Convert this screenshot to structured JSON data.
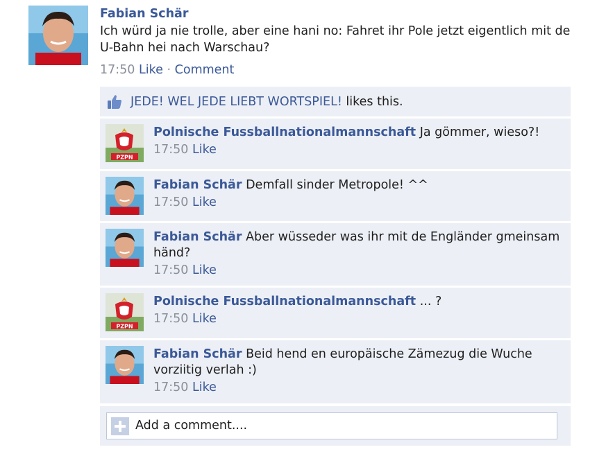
{
  "post": {
    "author": "Fabian Schär",
    "text": "Ich würd ja nie trolle, aber eine hani no: Fahret ihr Pole jetzt eigentlich mit de U-Bahn hei nach Warschau?",
    "time": "17:50",
    "like_label": "Like",
    "separator": "·",
    "comment_label": "Comment"
  },
  "likes": {
    "liker": "JEDE! WEL JEDE LIEBT WORTSPIEL!",
    "suffix": " likes this."
  },
  "comments": [
    {
      "author": "Polnische Fussballnationalmannschaft",
      "text": "Ja gömmer, wieso?!",
      "time": "17:50",
      "like_label": "Like",
      "avatar": "pzpn-logo"
    },
    {
      "author": "Fabian Schär",
      "text": "Demfall sinder Metropole! ^^",
      "time": "17:50",
      "like_label": "Like",
      "avatar": "user-photo"
    },
    {
      "author": "Fabian Schär",
      "text": "Aber wüsseder was ihr mit de Engländer gmeinsam händ?",
      "time": "17:50",
      "like_label": "Like",
      "avatar": "user-photo"
    },
    {
      "author": "Polnische Fussballnationalmannschaft",
      "text": "... ?",
      "time": "17:50",
      "like_label": "Like",
      "avatar": "pzpn-logo"
    },
    {
      "author": "Fabian Schär",
      "text": "Beid hend en europäische Zämezug die Wuche vorziitig verlah :)",
      "time": "17:50",
      "like_label": "Like",
      "avatar": "user-photo"
    }
  ],
  "add_comment": {
    "placeholder": "Add a comment...."
  },
  "colors": {
    "link": "#3b5998",
    "meta": "#8a8f99",
    "comment_bg": "#eceff5"
  },
  "logo_text": "PZPN"
}
